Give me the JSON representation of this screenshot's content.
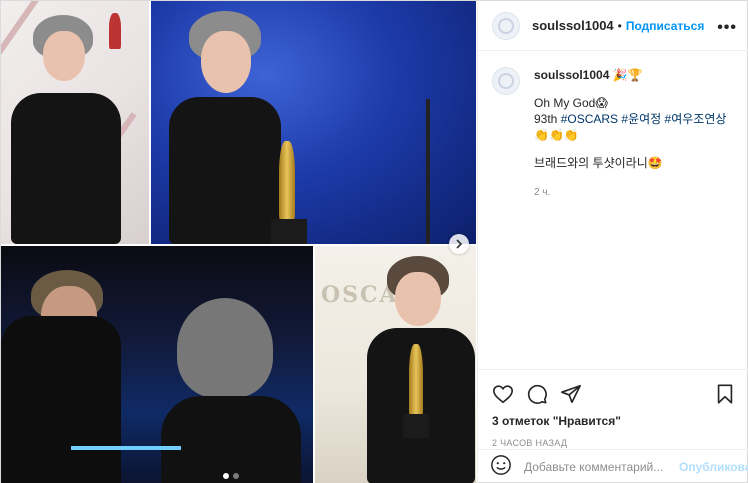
{
  "header": {
    "username": "soulssol1004",
    "separator": "•",
    "follow_label": "Подписаться",
    "more_label": "•••"
  },
  "caption": {
    "username": "soulssol1004",
    "username_emoji": "🎉🏆",
    "line1": "Oh My God",
    "line1_emoji": "😱",
    "line2_prefix": "93th",
    "hashtags": [
      "#OSCARS",
      "#윤여정",
      "#여우조연상"
    ],
    "line3_emoji": "👏👏👏",
    "line4": "브래드와의 투샷이라니",
    "line4_emoji": "🤩",
    "time": "2 ч."
  },
  "media": {
    "oscar_sign_text": "OSCA",
    "carousel_dots": 2,
    "active_dot": 0
  },
  "actions": {
    "likes_text": "3 отметок \"Нравится\"",
    "posted_ago": "2 ЧАСОВ НАЗАД"
  },
  "comment_box": {
    "placeholder": "Добавьте комментарий...",
    "publish_label": "Опубликовать"
  },
  "colors": {
    "accent": "#0095f6",
    "publish_disabled": "#b2dffc",
    "hashtag": "#00376b",
    "secondary_text": "#8e8e8e"
  }
}
